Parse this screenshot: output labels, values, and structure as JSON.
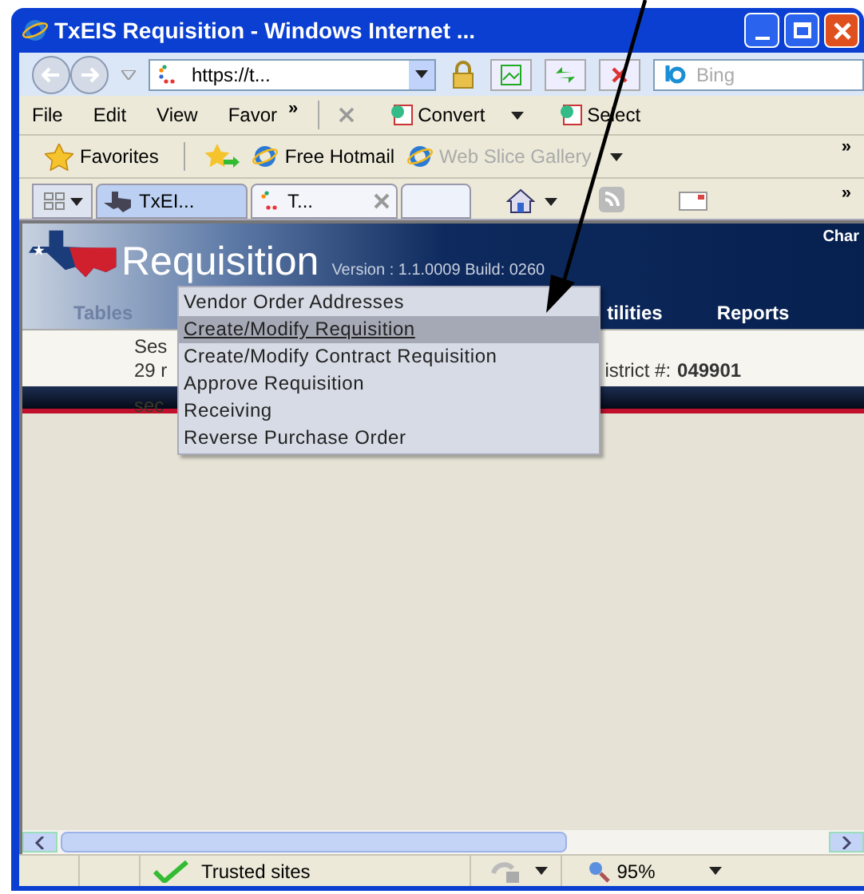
{
  "window": {
    "title": "TxEIS Requisition - Windows Internet ..."
  },
  "address_bar": {
    "url": "https://t...",
    "search_placeholder": "Bing"
  },
  "menu_bar": {
    "items": [
      "File",
      "Edit",
      "View",
      "Favor"
    ],
    "more": "»",
    "commands": [
      {
        "label": "Convert"
      },
      {
        "label": "Select"
      }
    ]
  },
  "favorites_bar": {
    "label": "Favorites",
    "links": [
      {
        "label": "Free Hotmail",
        "disabled": false
      },
      {
        "label": "Web Slice Gallery",
        "disabled": true
      }
    ],
    "more": "»"
  },
  "tabs": [
    {
      "label": "TxEI...",
      "selected": false
    },
    {
      "label": "T...",
      "selected": true
    }
  ],
  "tab_toolbar_more": "»",
  "app": {
    "title": "Requisition",
    "version": "Version : 1.1.0009 Build: 0260",
    "corner_text": "Char",
    "nav": [
      {
        "label": "Tables",
        "faded": true
      },
      {
        "label": "tilities",
        "faded": false
      },
      {
        "label": "Reports",
        "faded": false
      }
    ],
    "session_lines": [
      "Ses",
      "29 r"
    ],
    "district_label": "istrict #:",
    "district_number": "049901",
    "faded_text": "sec"
  },
  "dropdown": [
    {
      "label": "Vendor Order Addresses",
      "selected": false
    },
    {
      "label": "Create/Modify Requisition",
      "selected": true
    },
    {
      "label": "Create/Modify Contract Requisition",
      "selected": false
    },
    {
      "label": "Approve Requisition",
      "selected": false
    },
    {
      "label": "Receiving",
      "selected": false
    },
    {
      "label": "Reverse Purchase Order",
      "selected": false
    }
  ],
  "status_bar": {
    "zone": "Trusted sites",
    "zoom": "95%"
  }
}
